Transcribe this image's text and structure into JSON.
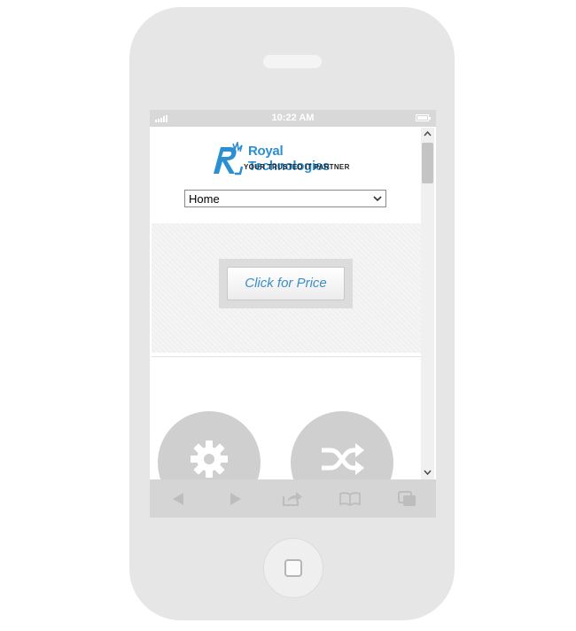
{
  "status_bar": {
    "time": "10:22 AM"
  },
  "site": {
    "brand_name": "Royal Technologies",
    "tagline": "YOUR TRUSTED IT PARTNER",
    "nav_selected": "Home",
    "price_button_label": "Click for Price"
  },
  "features": [
    {
      "icon": "gear-icon"
    },
    {
      "icon": "shuffle-icon"
    }
  ],
  "toolbar": {
    "items": [
      "back-icon",
      "forward-icon",
      "share-icon",
      "bookmarks-icon",
      "tabs-icon"
    ]
  },
  "colors": {
    "brand_blue": "#2b8fd1",
    "button_text": "#3b8fc4",
    "chrome_gray": "#d5d5d5"
  }
}
